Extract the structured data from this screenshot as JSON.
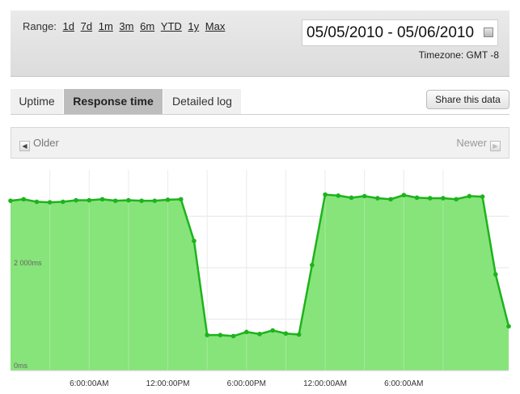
{
  "range": {
    "label": "Range:",
    "options": [
      "1d",
      "7d",
      "1m",
      "3m",
      "6m",
      "YTD",
      "1y",
      "Max"
    ]
  },
  "date_range": "05/05/2010 - 05/06/2010",
  "timezone": "Timezone: GMT -8",
  "tabs": [
    {
      "label": "Uptime",
      "active": false
    },
    {
      "label": "Response time",
      "active": true
    },
    {
      "label": "Detailed log",
      "active": false
    }
  ],
  "share_label": "Share this data",
  "nav": {
    "older": "Older",
    "newer": "Newer"
  },
  "icons": {
    "calendar": "calendar-icon",
    "left": "arrow-left-icon",
    "right": "arrow-right-icon"
  },
  "colors": {
    "fill": "#86e47a",
    "line": "#1db31d",
    "active_tab": "#bdbdbd"
  },
  "chart_data": {
    "type": "area",
    "ylabels": [
      "0ms",
      "2 000ms"
    ],
    "yticks": [
      0,
      2000
    ],
    "ylim": [
      0,
      3900
    ],
    "xlabels": [
      "6:00:00AM",
      "12:00:00PM",
      "6:00:00PM",
      "12:00:00AM",
      "6:00:00AM"
    ],
    "x_start_hour": 0,
    "x_tick_hours": [
      6,
      12,
      18,
      24,
      30
    ],
    "grid": true,
    "series": [
      {
        "x": [
          0,
          1,
          2,
          3,
          4,
          5,
          6,
          7,
          8,
          9,
          10,
          11,
          12,
          13,
          14,
          15,
          16,
          17,
          18,
          19,
          20,
          21,
          22,
          23,
          24,
          25,
          26,
          27,
          28,
          29,
          30,
          31,
          32,
          33,
          34,
          35,
          36,
          37,
          38
        ],
        "values": [
          3300,
          3330,
          3280,
          3270,
          3280,
          3310,
          3310,
          3330,
          3300,
          3310,
          3300,
          3300,
          3320,
          3330,
          2520,
          690,
          690,
          670,
          750,
          710,
          780,
          720,
          700,
          2050,
          3420,
          3400,
          3360,
          3390,
          3350,
          3330,
          3410,
          3360,
          3350,
          3350,
          3330,
          3390,
          3380,
          1870,
          860
        ]
      }
    ]
  }
}
